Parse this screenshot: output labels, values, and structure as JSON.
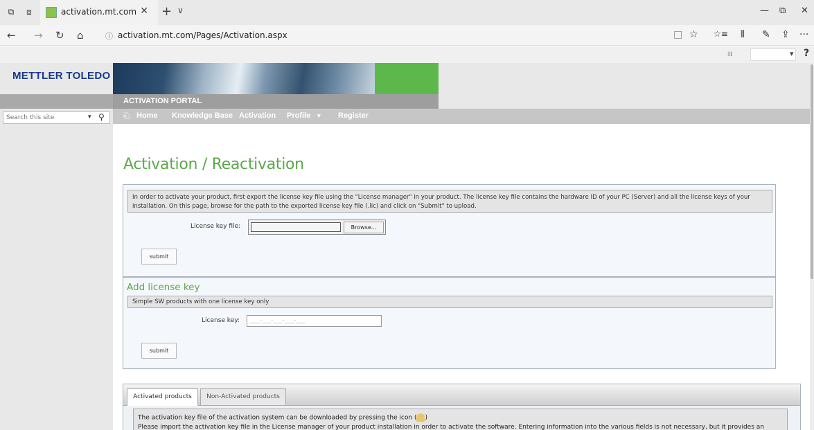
{
  "browser": {
    "tab_title": "activation.mt.com",
    "tab_close": "✕",
    "new_tab": "+",
    "tab_list": "∨",
    "minimize": "—",
    "maximize": "⧉",
    "close": "✕",
    "back": "←",
    "forward": "→",
    "refresh": "↻",
    "home": "⌂",
    "url_info": "ⓘ",
    "url": "activation.mt.com/Pages/Activation.aspx",
    "reading_view": "□",
    "favorite": "☆",
    "favorites_hub": "☆≡",
    "library": "⫴",
    "notes": "✎",
    "share": "⇪",
    "more": "···",
    "fit_icon": "⌗",
    "ext_drop": "▾",
    "ext_help": "?"
  },
  "site": {
    "logo": "METTLER TOLEDO",
    "portal_title": "ACTIVATION PORTAL",
    "search_placeholder": "Search this site",
    "search_drop": "▾",
    "search_go": "⚲",
    "home_icon": "⎗"
  },
  "menu": {
    "home": "Home",
    "knowledge_base": "Knowledge Base",
    "activation": "Activation",
    "profile": "Profile",
    "profile_caret": "▾",
    "register": "Register"
  },
  "main": {
    "title": "Activation / Reactivation",
    "activation_panel": {
      "info": "In order to activate your product, first export the license key file using the \"License manager\" in your product. The license key file contains the hardware ID of your PC (Server) and all the license keys of your installation. On this page, browse for the path to the exported license key file (.lic) and click on \"Submit\" to upload.",
      "file_label": "License key file:",
      "browse": "Browse...",
      "submit": "submit"
    },
    "license_panel": {
      "heading": "Add license key",
      "info": "Simple SW products with one license key only",
      "key_label": "License key:",
      "key_placeholder": "____-____-____-____-____",
      "submit": "submit"
    },
    "tabs": {
      "active": "Activated products",
      "inactive": "Non-Activated products",
      "content_line1_a": "The activation key file of the activation system can be downloaded by pressing the icon (",
      "content_line1_b": ")",
      "content_line2": "Please import the activation key file in the License manager of your product installation in order to activate the software. Entering information into the various fields is not necessary, but it provides an overview."
    }
  }
}
